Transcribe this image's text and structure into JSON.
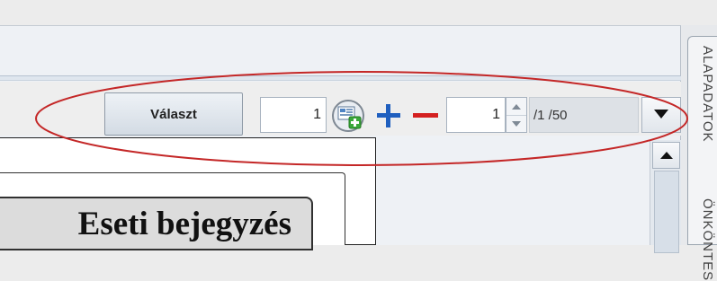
{
  "toolbar": {
    "choose_label": "Választ",
    "page_value": "1",
    "count_value": "1",
    "range_label": "/1 /50",
    "icons": {
      "add_page": "add-page-icon",
      "plus": "plus-icon",
      "minus": "minus-icon",
      "spin_up": "up-arrow-icon",
      "spin_down": "down-arrow-icon",
      "dropdown": "chevron-down-icon"
    }
  },
  "document": {
    "title": "Eseti bejegyzés"
  },
  "side_tabs": {
    "tab1_label": "ALAPADATOK",
    "tab2_label": "ÖNKÖNTES"
  },
  "colors": {
    "annotation": "#c42727",
    "plus": "#1f5fbf",
    "minus": "#d42020",
    "add_green": "#3aa83a"
  }
}
